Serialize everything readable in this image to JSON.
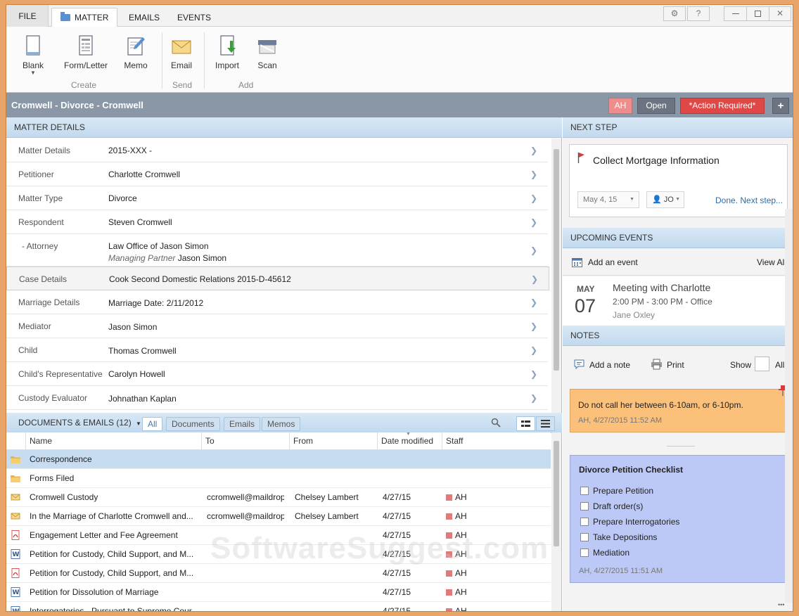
{
  "tabs": {
    "file": "FILE",
    "matter": "MATTER",
    "emails": "EMAILS",
    "events": "EVENTS"
  },
  "window_buttons": {
    "help": "?",
    "close": "✕"
  },
  "ribbon": {
    "blank": "Blank",
    "form_letter": "Form/Letter",
    "memo": "Memo",
    "email": "Email",
    "import": "Import",
    "scan": "Scan",
    "group_create": "Create",
    "group_send": "Send",
    "group_add": "Add"
  },
  "titlebar": {
    "title": "Cromwell - Divorce - Cromwell",
    "user_badge": "AH",
    "status": "Open",
    "action": "*Action Required*",
    "add": "+"
  },
  "matter_details": {
    "header": "MATTER DETAILS",
    "rows": [
      {
        "label": "Matter Details",
        "value": "2015-XXX -"
      },
      {
        "label": "Petitioner",
        "value": "Charlotte Cromwell"
      },
      {
        "label": "Matter Type",
        "value": "Divorce"
      },
      {
        "label": "Respondent",
        "value": "Steven Cromwell"
      },
      {
        "label": "-  Attorney",
        "value": "Law Office of Jason Simon",
        "role": "Managing Partner",
        "role_value": "Jason Simon"
      },
      {
        "label": "Case Details",
        "value": "Cook Second Domestic Relations 2015-D-45612"
      },
      {
        "label": "Marriage Details",
        "value": "Marriage Date: 2/11/2012"
      },
      {
        "label": "Mediator",
        "value": "Jason Simon"
      },
      {
        "label": "Child",
        "value": "Thomas Cromwell"
      },
      {
        "label": "Child's Representative",
        "value": "Carolyn Howell"
      },
      {
        "label": "Custody Evaluator",
        "value": "Johnathan Kaplan"
      }
    ]
  },
  "documents": {
    "header": "DOCUMENTS & EMAILS (12)",
    "filters": [
      "All",
      "Documents",
      "Emails",
      "Memos"
    ],
    "columns": [
      "Name",
      "To",
      "From",
      "Date modified",
      "Staff"
    ],
    "rows": [
      {
        "type": "folder",
        "name": "Correspondence",
        "to": "",
        "from": "",
        "date": "",
        "staff": ""
      },
      {
        "type": "folder",
        "name": "Forms Filed",
        "to": "",
        "from": "",
        "date": "",
        "staff": ""
      },
      {
        "type": "email",
        "name": "Cromwell Custody",
        "to": "ccromwell@maildrop",
        "from": "Chelsey Lambert",
        "date": "4/27/15",
        "staff": "AH"
      },
      {
        "type": "email",
        "name": "In the Marriage of Charlotte Cromwell and...",
        "to": "ccromwell@maildrop",
        "from": "Chelsey Lambert",
        "date": "4/27/15",
        "staff": "AH"
      },
      {
        "type": "pdf",
        "name": "Engagement Letter and Fee Agreement",
        "to": "",
        "from": "",
        "date": "4/27/15",
        "staff": "AH"
      },
      {
        "type": "word",
        "name": "Petition for Custody, Child Support, and M...",
        "to": "",
        "from": "",
        "date": "4/27/15",
        "staff": "AH"
      },
      {
        "type": "pdf",
        "name": "Petition for Custody, Child Support, and M...",
        "to": "",
        "from": "",
        "date": "4/27/15",
        "staff": "AH"
      },
      {
        "type": "word",
        "name": "Petition for Dissolution of Marriage",
        "to": "",
        "from": "",
        "date": "4/27/15",
        "staff": "AH"
      },
      {
        "type": "word",
        "name": "Interrogatories - Pursuant to Supreme Cour...",
        "to": "",
        "from": "",
        "date": "4/27/15",
        "staff": "AH"
      }
    ]
  },
  "next_step": {
    "header": "NEXT STEP",
    "title": "Collect Mortgage Information",
    "date": "May 4, 15",
    "assignee": "JO",
    "action": "Done. Next step..."
  },
  "upcoming_events": {
    "header": "UPCOMING EVENTS",
    "add": "Add an event",
    "view_all": "View All",
    "event": {
      "month": "MAY",
      "day": "07",
      "title": "Meeting with Charlotte",
      "time": "2:00 PM - 3:00 PM - Office",
      "person": "Jane Oxley"
    }
  },
  "notes": {
    "header": "NOTES",
    "add": "Add a note",
    "print": "Print",
    "show": "Show",
    "show_value": "All",
    "note1": {
      "text": "Do not call her between 6-10am, or 6-10pm.",
      "meta": "AH, 4/27/2015 11:52 AM"
    },
    "note2": {
      "title": "Divorce Petition Checklist",
      "items": [
        "Prepare Petition",
        "Draft order(s)",
        "Prepare Interrogatories",
        "Take Depositions",
        "Mediation"
      ],
      "meta": "AH, 4/27/2015 11:51 AM"
    },
    "more": "•••"
  },
  "watermark": "SoftwareSuggest.com",
  "colors": {
    "accent": "#5a8fd0",
    "action_required": "#e04848",
    "note_orange": "#fbc07a",
    "note_blue": "#bcc8f5"
  }
}
